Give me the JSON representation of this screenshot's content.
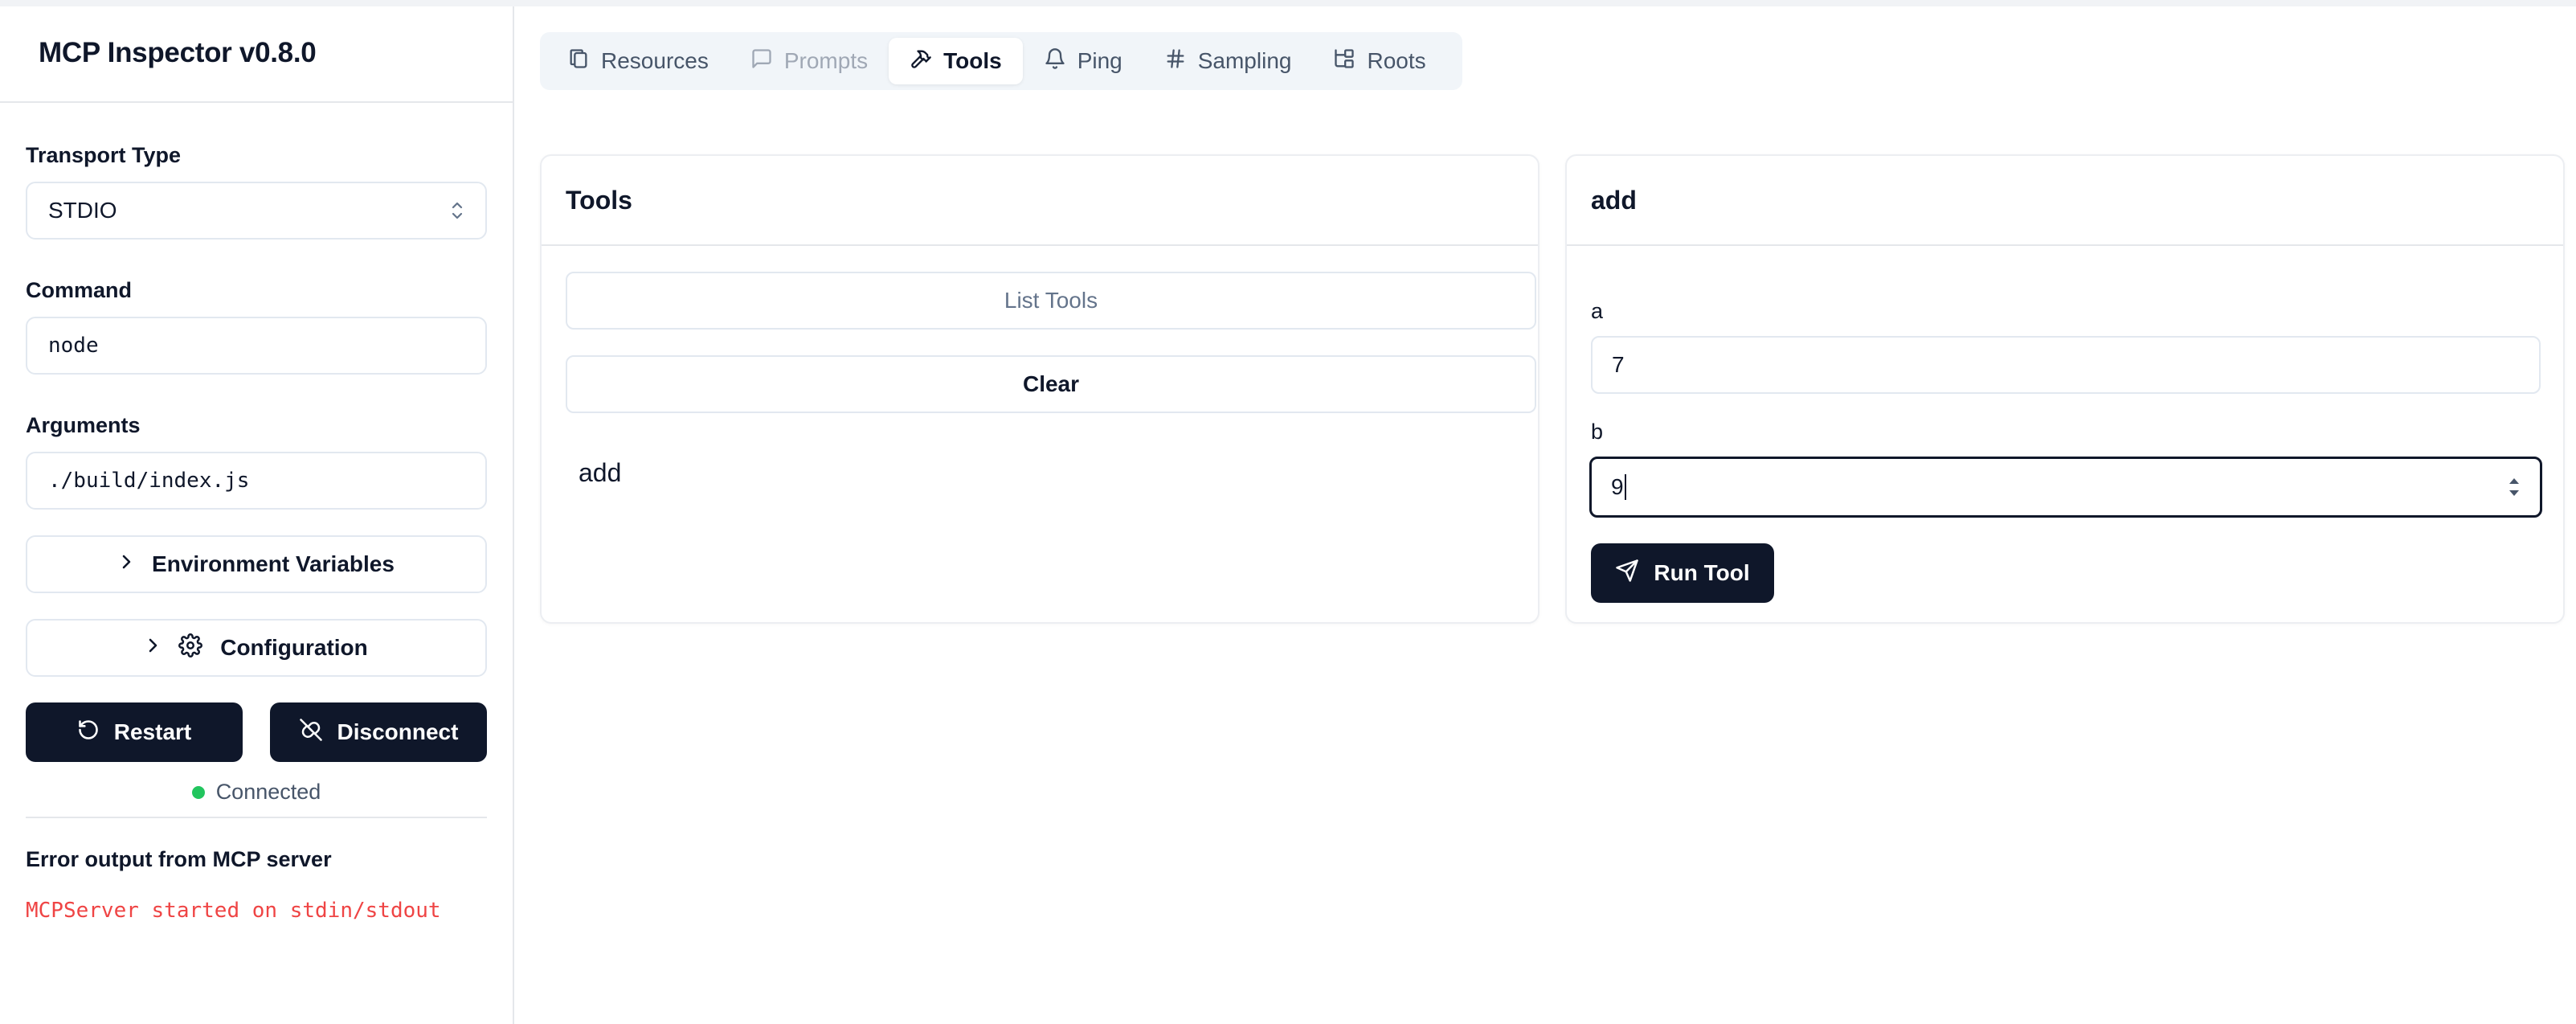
{
  "app": {
    "title": "MCP Inspector v0.8.0"
  },
  "sidebar": {
    "transport": {
      "label": "Transport Type",
      "value": "STDIO"
    },
    "command": {
      "label": "Command",
      "value": "node"
    },
    "arguments": {
      "label": "Arguments",
      "value": "./build/index.js"
    },
    "env_button": "Environment Variables",
    "config_button": "Configuration",
    "restart_button": "Restart",
    "disconnect_button": "Disconnect",
    "status": "Connected",
    "error_title": "Error output from MCP server",
    "error_line": "MCPServer started on stdin/stdout"
  },
  "tabs": [
    {
      "label": "Resources",
      "icon": "files-icon"
    },
    {
      "label": "Prompts",
      "icon": "message-icon"
    },
    {
      "label": "Tools",
      "icon": "hammer-icon"
    },
    {
      "label": "Ping",
      "icon": "bell-icon"
    },
    {
      "label": "Sampling",
      "icon": "hash-icon"
    },
    {
      "label": "Roots",
      "icon": "folder-tree-icon"
    }
  ],
  "tools_panel": {
    "title": "Tools",
    "list_button": "List Tools",
    "clear_button": "Clear",
    "items": [
      "add"
    ]
  },
  "tool_detail": {
    "title": "add",
    "params": [
      {
        "name": "a",
        "value": "7"
      },
      {
        "name": "b",
        "value": "9"
      }
    ],
    "run_button": "Run Tool"
  },
  "colors": {
    "primary": "#0f172a",
    "status_ok": "#22c55e",
    "error_text": "#ef4444",
    "tabbar_bg": "#f1f5f9"
  }
}
